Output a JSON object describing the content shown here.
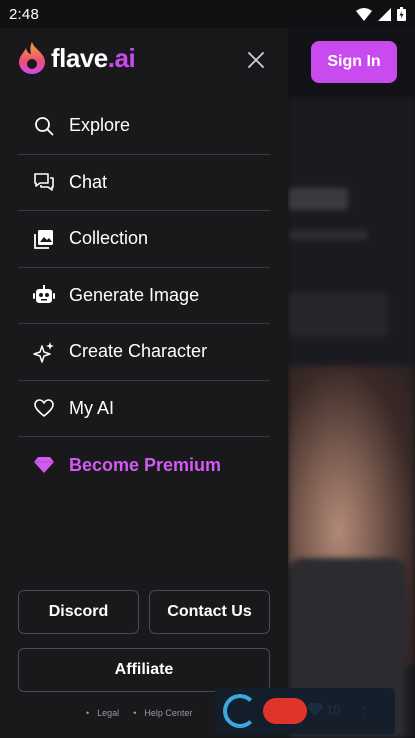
{
  "status_bar": {
    "time": "2:48"
  },
  "logo": {
    "name": "flave",
    "suffix": ".ai"
  },
  "header": {
    "sign_in_label": "Sign In"
  },
  "menu": {
    "items": [
      {
        "label": "Explore",
        "icon": "search-icon"
      },
      {
        "label": "Chat",
        "icon": "chat-icon"
      },
      {
        "label": "Collection",
        "icon": "image-gallery-icon"
      },
      {
        "label": "Generate Image",
        "icon": "robot-icon"
      },
      {
        "label": "Create Character",
        "icon": "sparkles-icon"
      },
      {
        "label": "My AI",
        "icon": "heart-icon"
      },
      {
        "label": "Become Premium",
        "icon": "diamond-icon"
      }
    ]
  },
  "buttons": {
    "discord": "Discord",
    "contact": "Contact Us",
    "affiliate": "Affiliate"
  },
  "footer": {
    "legal": "Legal",
    "help": "Help Center"
  },
  "background": {
    "gems_count": "10"
  },
  "colors": {
    "accent": "#c94bf0",
    "premium": "#d15af2",
    "drawer_bg": "#19191c",
    "page_bg": "#111114"
  }
}
